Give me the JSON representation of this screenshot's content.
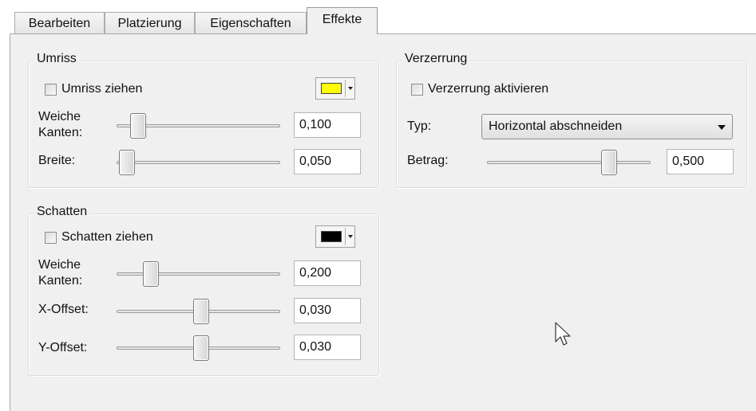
{
  "tabs": [
    {
      "label": "Bearbeiten",
      "active": false
    },
    {
      "label": "Platzierung",
      "active": false
    },
    {
      "label": "Eigenschaften",
      "active": false
    },
    {
      "label": "Effekte",
      "active": true
    }
  ],
  "umriss": {
    "title": "Umriss",
    "checkbox_label": "Umriss ziehen",
    "checked": false,
    "color": "#ffff00",
    "soft_edges_label_line1": "Weiche",
    "soft_edges_label_line2": "Kanten:",
    "soft_edges_value": "0,100",
    "width_label": "Breite:",
    "width_value": "0,050"
  },
  "schatten": {
    "title": "Schatten",
    "checkbox_label": "Schatten ziehen",
    "checked": false,
    "color": "#000000",
    "soft_edges_label_line1": "Weiche",
    "soft_edges_label_line2": "Kanten:",
    "soft_edges_value": "0,200",
    "x_offset_label": "X-Offset:",
    "x_offset_value": "0,030",
    "y_offset_label": "Y-Offset:",
    "y_offset_value": "0,030"
  },
  "verzerrung": {
    "title": "Verzerrung",
    "checkbox_label": "Verzerrung aktivieren",
    "checked": false,
    "type_label": "Typ:",
    "type_value": "Horizontal abschneiden",
    "amount_label": "Betrag:",
    "amount_value": "0,500"
  },
  "icons": {
    "cursor": "arrow-cursor-icon",
    "color_dropdown": "chevron-down-icon"
  }
}
